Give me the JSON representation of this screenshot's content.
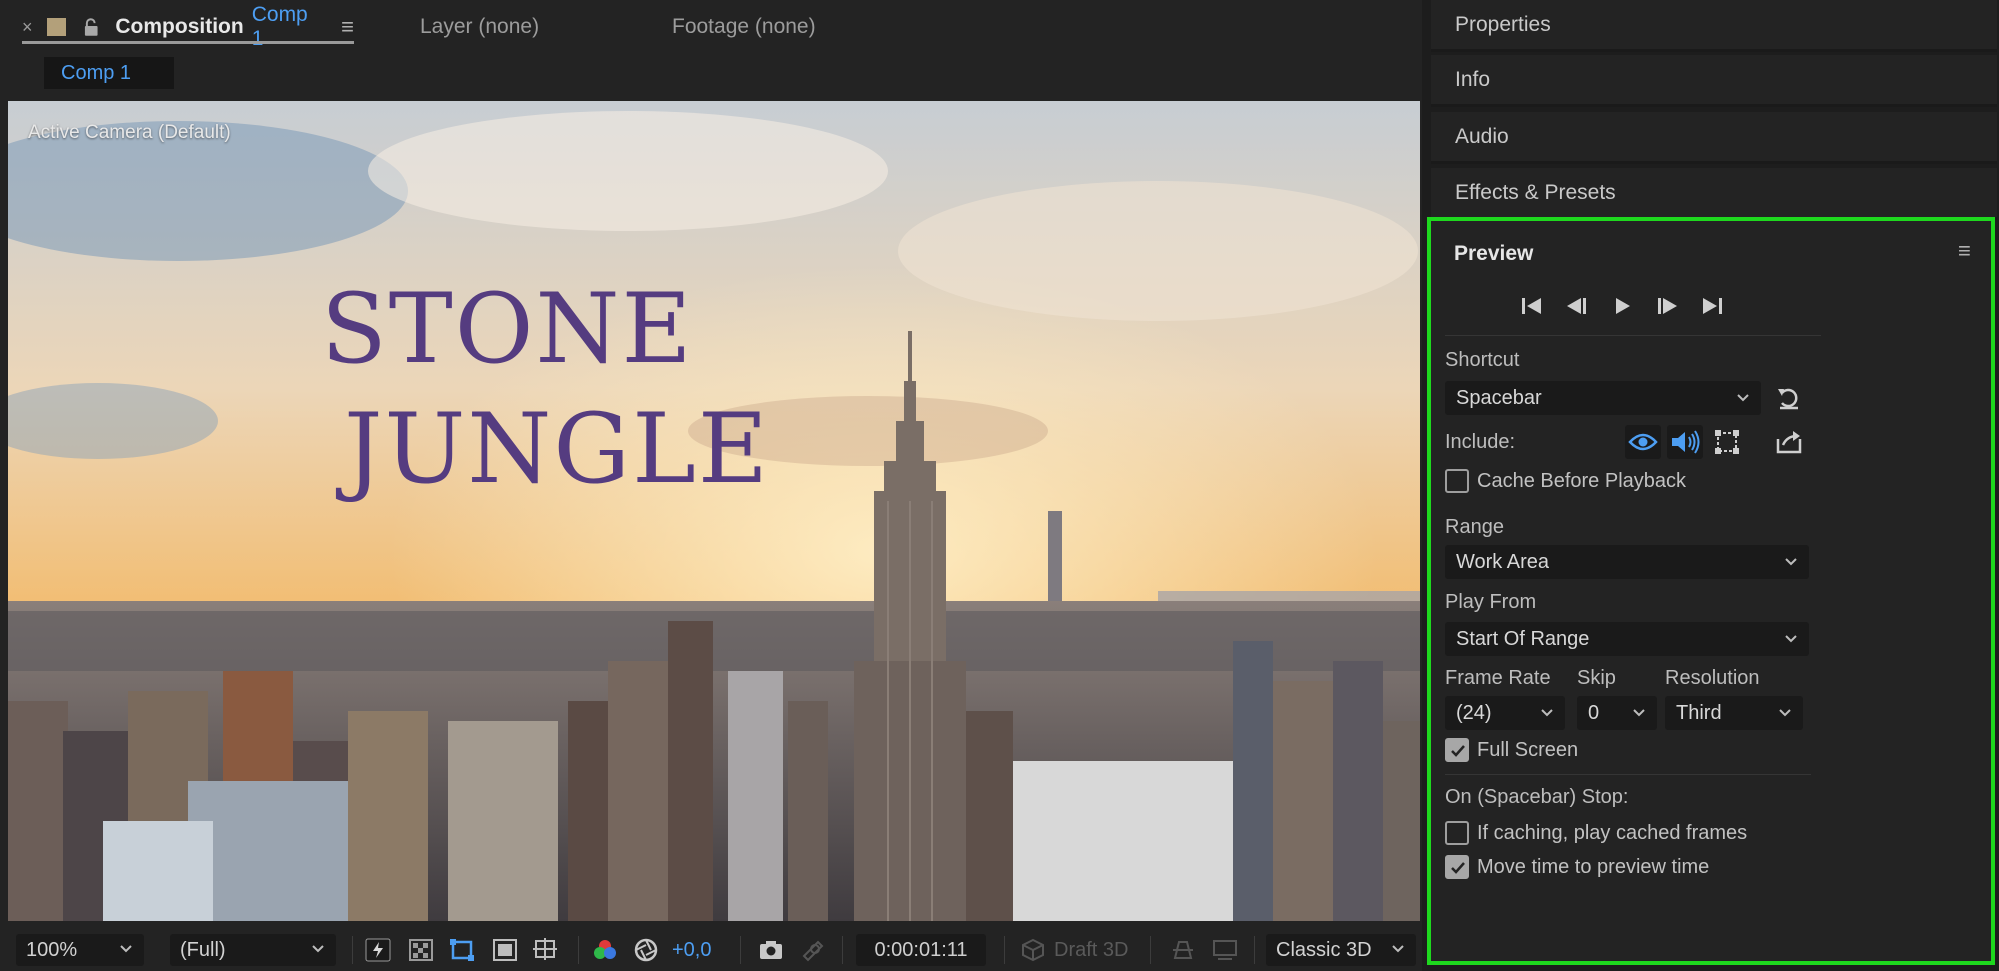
{
  "composition_panel": {
    "tabs": [
      {
        "close": "×",
        "label": "Composition",
        "name": "Comp 1",
        "menu": "≡"
      },
      {
        "label": "Layer (none)"
      },
      {
        "label": "Footage (none)"
      }
    ],
    "comp_chip": "Comp 1",
    "viewer": {
      "camera_label": "Active Camera (Default)",
      "title_line_1": "STONE",
      "title_line_2": "JUNGLE"
    },
    "toolbar": {
      "magnification": "100%",
      "resolution": "(Full)",
      "exposure": "+0,0",
      "timecode": "0:00:01:11",
      "draft_3d": "Draft 3D",
      "renderer": "Classic 3D"
    }
  },
  "side_panels": [
    {
      "title": "Properties"
    },
    {
      "title": "Info"
    },
    {
      "title": "Audio"
    },
    {
      "title": "Effects & Presets"
    }
  ],
  "preview": {
    "title": "Preview",
    "menu": "≡",
    "shortcut_label": "Shortcut",
    "shortcut_value": "Spacebar",
    "include_label": "Include:",
    "cache_before_playback": {
      "label": "Cache Before Playback",
      "checked": false
    },
    "range_label": "Range",
    "range_value": "Work Area",
    "play_from_label": "Play From",
    "play_from_value": "Start Of Range",
    "frame_rate_label": "Frame Rate",
    "frame_rate_value": "(24)",
    "skip_label": "Skip",
    "skip_value": "0",
    "resolution_label": "Resolution",
    "resolution_value": "Third",
    "full_screen": {
      "label": "Full Screen",
      "checked": true
    },
    "stop_label": "On (Spacebar) Stop:",
    "if_caching": {
      "label": "If caching, play cached frames",
      "checked": false
    },
    "move_time": {
      "label": "Move time to preview time",
      "checked": true
    }
  },
  "colors": {
    "accent_blue": "#4d9ef2",
    "highlight_green": "#1ed81e",
    "title_purple": "#553c80"
  }
}
